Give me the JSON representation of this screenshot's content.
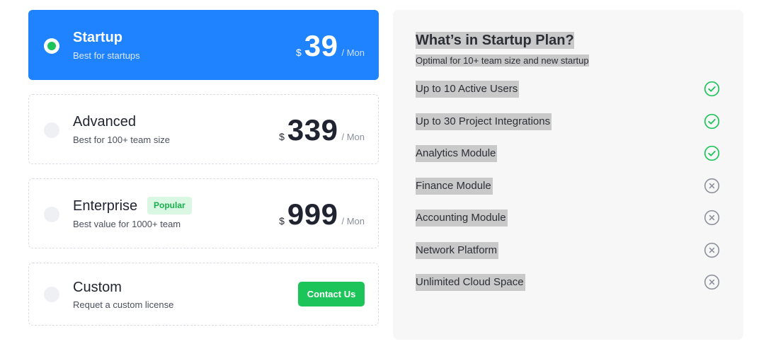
{
  "plans": [
    {
      "name": "Startup",
      "description": "Best for startups",
      "currency": "$",
      "price": "39",
      "period": "/ Mon",
      "selected": true
    },
    {
      "name": "Advanced",
      "description": "Best for 100+ team size",
      "currency": "$",
      "price": "339",
      "period": "/ Mon",
      "selected": false
    },
    {
      "name": "Enterprise",
      "badge": "Popular",
      "description": "Best value for 1000+ team",
      "currency": "$",
      "price": "999",
      "period": "/ Mon",
      "selected": false
    },
    {
      "name": "Custom",
      "description": "Requet a custom license",
      "button_label": "Contact Us",
      "selected": false
    }
  ],
  "details": {
    "title": "What’s in Startup Plan?",
    "subtitle": "Optimal for 10+ team size and new startup",
    "features": [
      {
        "label": "Up to 10 Active Users",
        "included": true,
        "icon": "check-circle-icon"
      },
      {
        "label": "Up to 30 Project Integrations",
        "included": true,
        "icon": "check-circle-icon"
      },
      {
        "label": "Analytics Module",
        "included": true,
        "icon": "check-circle-icon"
      },
      {
        "label": "Finance Module",
        "included": false,
        "icon": "x-circle-icon"
      },
      {
        "label": "Accounting Module",
        "included": false,
        "icon": "x-circle-icon"
      },
      {
        "label": "Network Platform",
        "included": false,
        "icon": "x-circle-icon"
      },
      {
        "label": "Unlimited Cloud Space",
        "included": false,
        "icon": "x-circle-icon"
      }
    ]
  },
  "colors": {
    "selected_bg": "#1f82ff",
    "accent_green": "#1dc45a",
    "included_icon": "#1dc45a",
    "excluded_icon": "#8d919b",
    "panel_bg": "#f7f7f7"
  }
}
